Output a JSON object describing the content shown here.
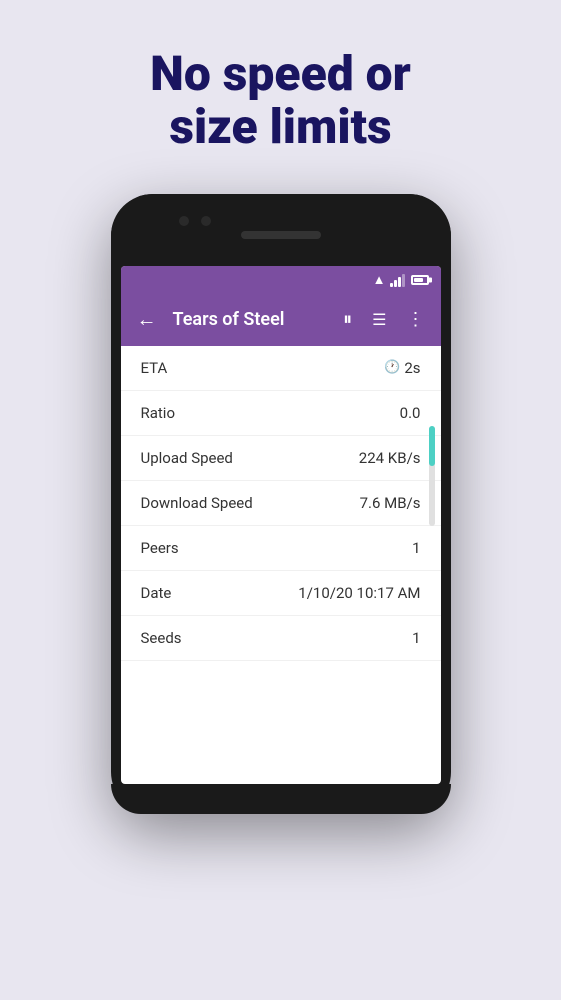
{
  "background_color": "#e8e6f0",
  "headline": {
    "line1": "No speed or",
    "line2": "size limits"
  },
  "toolbar": {
    "title": "Tears of Steel",
    "back_icon": "←",
    "pause_icon": "⏸",
    "list_icon": "☰",
    "more_icon": "⋮"
  },
  "rows": [
    {
      "label": "ETA",
      "value": "2s",
      "has_clock": true
    },
    {
      "label": "Ratio",
      "value": "0.0",
      "has_clock": false
    },
    {
      "label": "Upload Speed",
      "value": "224 KB/s",
      "has_clock": false
    },
    {
      "label": "Download Speed",
      "value": "7.6 MB/s",
      "has_clock": false
    },
    {
      "label": "Peers",
      "value": "1",
      "has_clock": false
    },
    {
      "label": "Date",
      "value": "1/10/20 10:17 AM",
      "has_clock": false
    },
    {
      "label": "Seeds",
      "value": "1",
      "has_clock": false
    }
  ],
  "accent_color": "#7b4ea0",
  "progress_color": "#4dd0c4"
}
